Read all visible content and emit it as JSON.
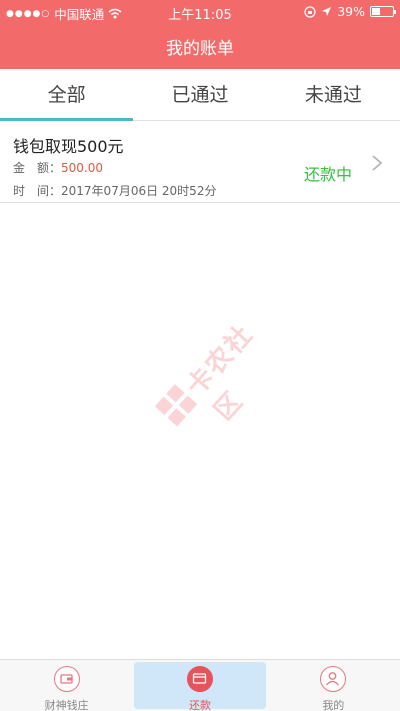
{
  "status_bar": {
    "carrier": "中国联通",
    "time": "上午11:05",
    "battery_pct": "39%",
    "battery_level": 0.39
  },
  "nav": {
    "title": "我的账单"
  },
  "tabs": [
    {
      "label": "全部",
      "active": true
    },
    {
      "label": "已通过",
      "active": false
    },
    {
      "label": "未通过",
      "active": false
    }
  ],
  "records": [
    {
      "title": "钱包取现500元",
      "amount_label": "金　额：",
      "amount_value": "500.00",
      "time_label": "时　间：",
      "time_value": "2017年07月06日 20时52分",
      "status": "还款中"
    }
  ],
  "watermark": {
    "text": "卡农社区"
  },
  "bottom_nav": [
    {
      "label": "财神钱庄",
      "icon": "wallet-icon",
      "active": false
    },
    {
      "label": "还款",
      "icon": "repay-card-icon",
      "active": true
    },
    {
      "label": "我的",
      "icon": "user-icon",
      "active": false
    }
  ],
  "colors": {
    "header": "#f36a6a",
    "tab_indicator": "#4ab9c6",
    "status_green": "#33c23f",
    "amount_red": "#e05a3e"
  }
}
